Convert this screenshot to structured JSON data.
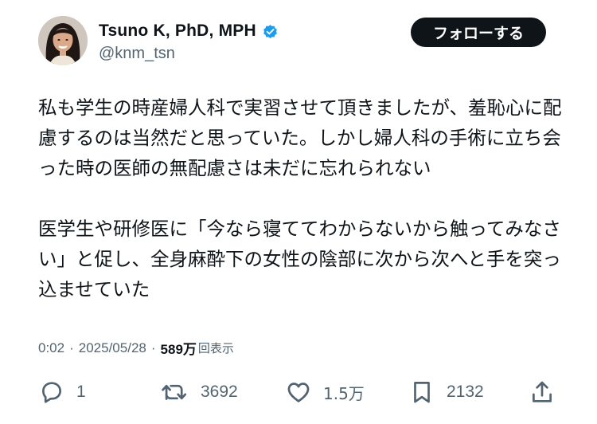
{
  "author": {
    "display_name": "Tsuno K, PhD, MPH",
    "handle": "@knm_tsn",
    "verified": true,
    "avatar": "profile-photo"
  },
  "follow_button": {
    "label": "フォローする"
  },
  "tweet": {
    "paragraphs": [
      [
        "私も学生の時産婦人科で実習させて頂きましたが、羞恥心に配",
        "慮するのは当然だと思っていた。しかし婦人科の手術に立ち会",
        "った時の医師の無配慮さは未だに忘れられない"
      ],
      [
        "医学生や研修医に「今なら寝ててわからないから触ってみなさ",
        "い」と促し、全身麻酔下の女性の陰部に次から次へと手を突っ",
        "込ませていた"
      ]
    ]
  },
  "meta": {
    "time": "0:02",
    "separator": "·",
    "date": "2025/05/28",
    "views_count": "589万",
    "views_label": "回表示"
  },
  "actions": {
    "reply": {
      "icon": "reply-icon",
      "count": "1"
    },
    "repost": {
      "icon": "repost-icon",
      "count": "3692"
    },
    "like": {
      "icon": "heart-icon",
      "count": "1.5万"
    },
    "bookmark": {
      "icon": "bookmark-icon",
      "count": "2132"
    },
    "share": {
      "icon": "share-icon"
    }
  },
  "colors": {
    "text_primary": "#0f1419",
    "text_secondary": "#536471",
    "verified_blue": "#1d9bf0",
    "follow_button_bg": "#0f1419",
    "follow_button_text": "#ffffff"
  }
}
